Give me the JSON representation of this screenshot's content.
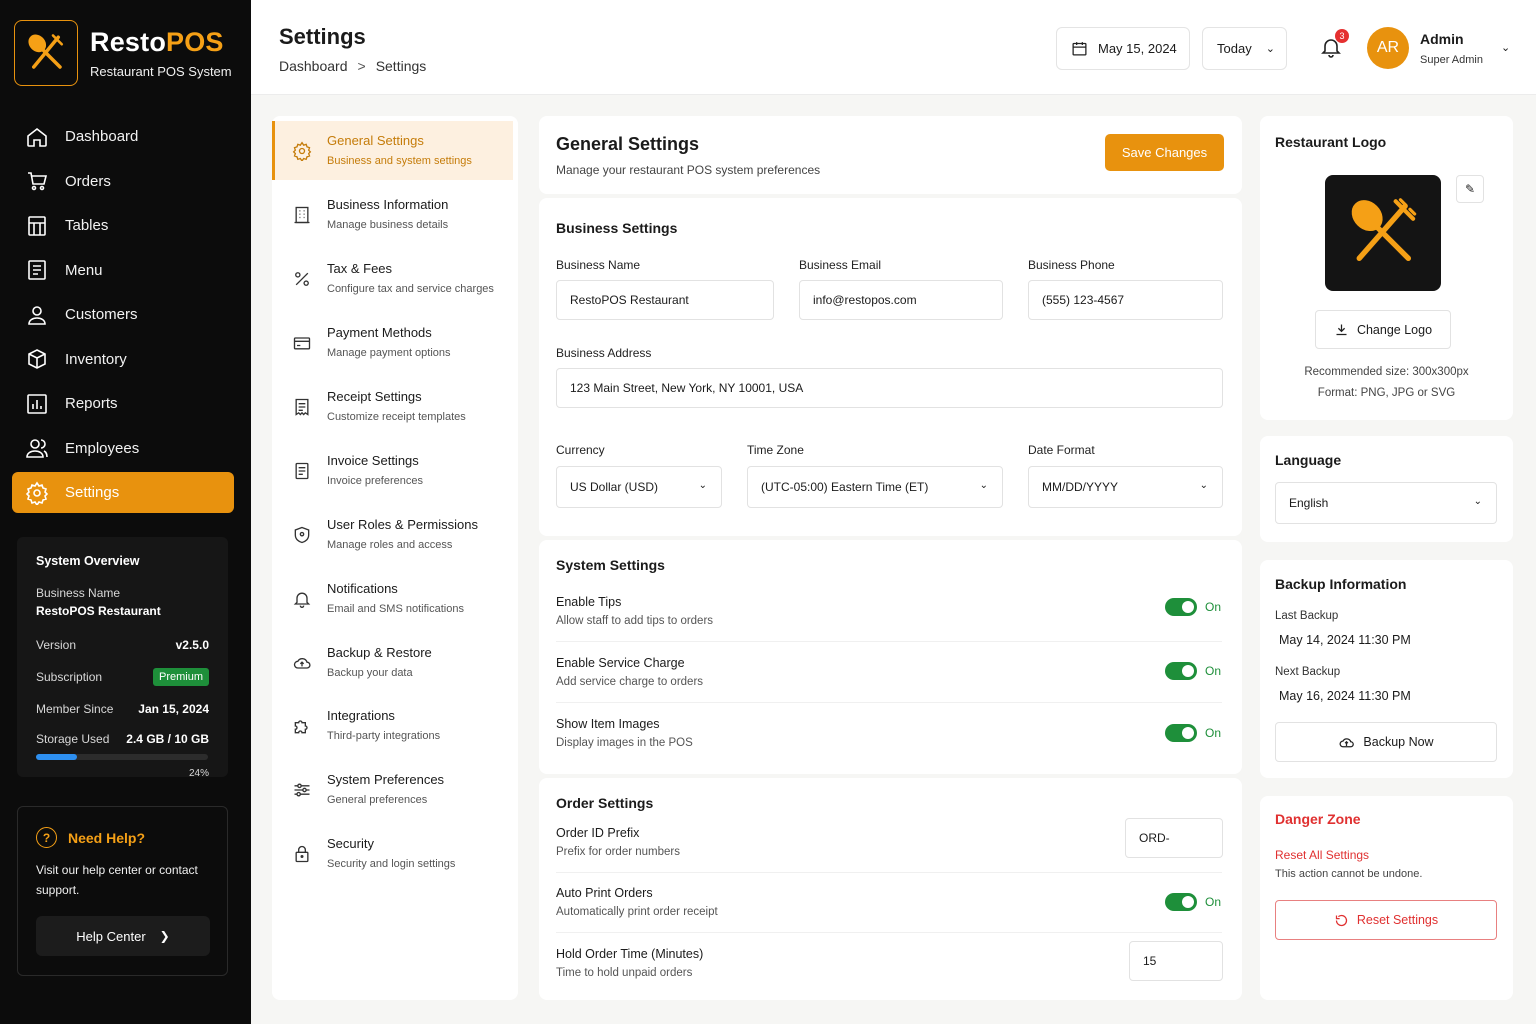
{
  "brand": {
    "name_main": "Resto",
    "name_accent": "POS",
    "subtitle": "Restaurant POS System",
    "accent_color": "#e8920e"
  },
  "nav": [
    {
      "label": "Dashboard",
      "icon": "home-icon"
    },
    {
      "label": "Orders",
      "icon": "cart-icon"
    },
    {
      "label": "Tables",
      "icon": "table-icon"
    },
    {
      "label": "Menu",
      "icon": "menu-icon"
    },
    {
      "label": "Customers",
      "icon": "user-icon"
    },
    {
      "label": "Inventory",
      "icon": "box-icon"
    },
    {
      "label": "Reports",
      "icon": "chart-icon"
    },
    {
      "label": "Employees",
      "icon": "users-icon"
    },
    {
      "label": "Settings",
      "icon": "gear-icon",
      "active": true
    }
  ],
  "overview": {
    "title": "System Overview",
    "business_label": "Business Name",
    "business_value": "RestoPOS Restaurant",
    "version_label": "Version",
    "version_value": "v2.5.0",
    "subscription_label": "Subscription",
    "subscription_value": "Premium",
    "member_label": "Member Since",
    "member_value": "Jan 15, 2024",
    "storage_label": "Storage Used",
    "storage_value": "2.4 GB / 10 GB",
    "storage_pct_text": "24%",
    "storage_pct": 0.24
  },
  "help": {
    "title": "Need Help?",
    "text": "Visit our help center or contact support.",
    "button": "Help Center"
  },
  "header": {
    "title": "Settings",
    "breadcrumb": [
      "Dashboard",
      "Settings"
    ],
    "date": "May 15, 2024",
    "range": "Today",
    "notifications": "3",
    "avatar_initials": "AR",
    "user_name": "Admin",
    "user_role": "Super Admin"
  },
  "settings_menu": [
    {
      "title": "General Settings",
      "desc": "Business and system settings",
      "icon": "gear-icon",
      "active": true
    },
    {
      "title": "Business Information",
      "desc": "Manage business details",
      "icon": "building-icon"
    },
    {
      "title": "Tax & Fees",
      "desc": "Configure tax and service charges",
      "icon": "percent-icon"
    },
    {
      "title": "Payment Methods",
      "desc": "Manage payment options",
      "icon": "card-icon"
    },
    {
      "title": "Receipt Settings",
      "desc": "Customize receipt templates",
      "icon": "receipt-icon"
    },
    {
      "title": "Invoice Settings",
      "desc": "Invoice preferences",
      "icon": "invoice-icon"
    },
    {
      "title": "User Roles & Permissions",
      "desc": "Manage roles and access",
      "icon": "shield-icon"
    },
    {
      "title": "Notifications",
      "desc": "Email and SMS notifications",
      "icon": "bell-icon"
    },
    {
      "title": "Backup & Restore",
      "desc": "Backup your data",
      "icon": "cloud-icon"
    },
    {
      "title": "Integrations",
      "desc": "Third-party integrations",
      "icon": "puzzle-icon"
    },
    {
      "title": "System Preferences",
      "desc": "General preferences",
      "icon": "sliders-icon"
    },
    {
      "title": "Security",
      "desc": "Security and login settings",
      "icon": "lock-icon"
    }
  ],
  "general": {
    "title": "General Settings",
    "desc": "Manage your restaurant POS system preferences",
    "save": "Save Changes"
  },
  "business": {
    "title": "Business Settings",
    "name_label": "Business Name",
    "name_value": "RestoPOS Restaurant",
    "email_label": "Business Email",
    "email_value": "info@restopos.com",
    "phone_label": "Business Phone",
    "phone_value": "(555) 123-4567",
    "address_label": "Business Address",
    "address_value": "123 Main Street, New York, NY 10001, USA",
    "currency_label": "Currency",
    "currency_value": "US Dollar (USD)",
    "tz_label": "Time Zone",
    "tz_value": "(UTC-05:00) Eastern Time (ET)",
    "date_label": "Date Format",
    "date_value": "MM/DD/YYYY"
  },
  "system": {
    "title": "System Settings",
    "rows": [
      {
        "title": "Enable Tips",
        "desc": "Allow staff to add tips to orders",
        "state": "On"
      },
      {
        "title": "Enable Service Charge",
        "desc": "Add service charge to orders",
        "state": "On"
      },
      {
        "title": "Show Item Images",
        "desc": "Display images in the POS",
        "state": "On"
      }
    ]
  },
  "order": {
    "title": "Order Settings",
    "prefix_title": "Order ID Prefix",
    "prefix_desc": "Prefix for order numbers",
    "prefix_value": "ORD-",
    "print_title": "Auto Print Orders",
    "print_desc": "Automatically print order receipt",
    "print_state": "On",
    "hold_title": "Hold Order Time (Minutes)",
    "hold_desc": "Time to hold unpaid orders",
    "hold_value": "15"
  },
  "logo": {
    "title": "Restaurant Logo",
    "change": "Change Logo",
    "note1": "Recommended size: 300x300px",
    "note2": "Format: PNG, JPG or SVG"
  },
  "language": {
    "title": "Language",
    "value": "English"
  },
  "backup": {
    "title": "Backup Information",
    "last_label": "Last Backup",
    "last_value": "May 14, 2024 11:30 PM",
    "next_label": "Next Backup",
    "next_value": "May 16, 2024 11:30 PM",
    "button": "Backup Now"
  },
  "danger": {
    "title": "Danger Zone",
    "link": "Reset All Settings",
    "desc": "This action cannot be undone.",
    "button": "Reset Settings"
  }
}
